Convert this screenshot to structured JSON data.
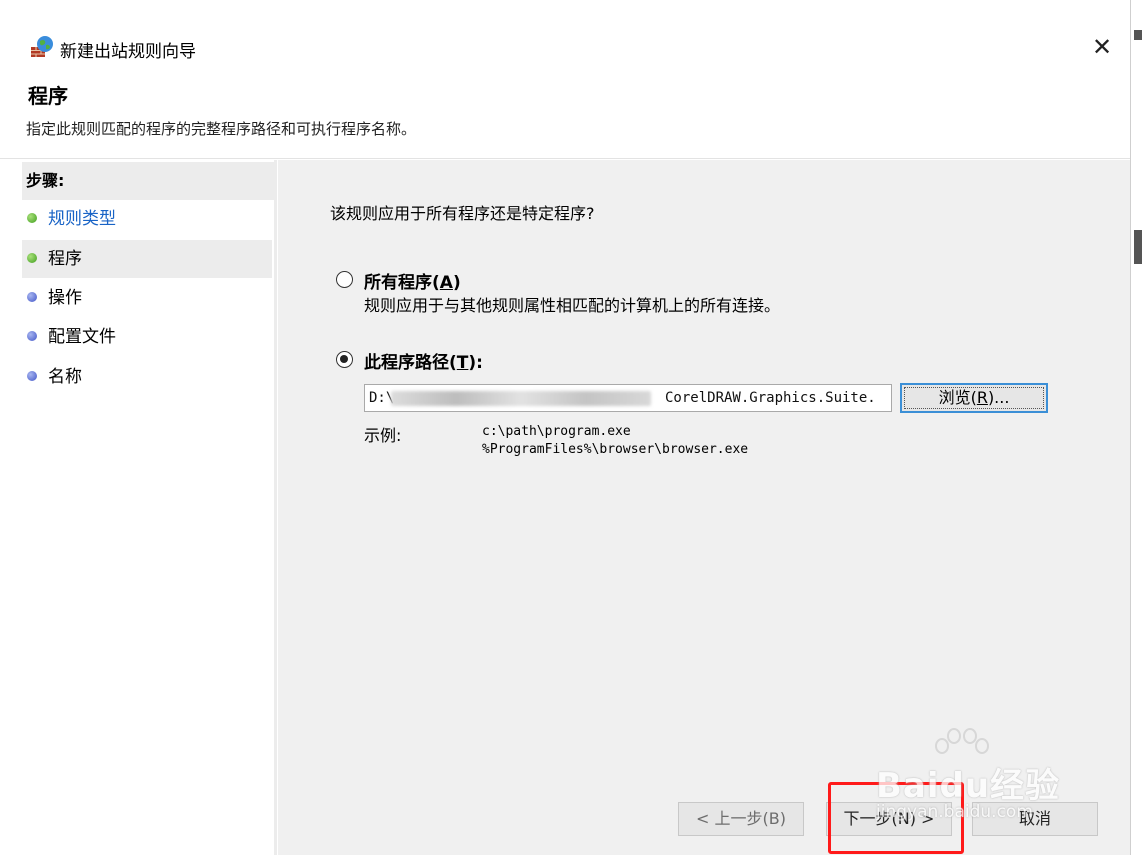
{
  "window": {
    "title": "新建出站规则向导",
    "close_glyph": "✕"
  },
  "header": {
    "title": "程序",
    "description": "指定此规则匹配的程序的完整程序路径和可执行程序名称。"
  },
  "sidebar": {
    "steps_label": "步骤:",
    "items": [
      {
        "label": "规则类型",
        "dot_color": "#3f9e1c",
        "state": "completed"
      },
      {
        "label": "程序",
        "dot_color": "#3f9e1c",
        "state": "current"
      },
      {
        "label": "操作",
        "dot_color": "#4155c8",
        "state": "pending"
      },
      {
        "label": "配置文件",
        "dot_color": "#4155c8",
        "state": "pending"
      },
      {
        "label": "名称",
        "dot_color": "#4155c8",
        "state": "pending"
      }
    ]
  },
  "content": {
    "question": "该规则应用于所有程序还是特定程序?",
    "all_programs": {
      "label_prefix": "所有程序(",
      "accel": "A",
      "label_suffix": ")",
      "description": "规则应用于与其他规则属性相匹配的计算机上的所有连接。",
      "checked": false
    },
    "program_path": {
      "label_prefix": "此程序路径(",
      "accel": "T",
      "label_suffix": "):",
      "checked": true,
      "value_start": "D:\\",
      "value_end": "CorelDRAW.Graphics.Suite."
    },
    "browse": {
      "label_prefix": "浏览(",
      "accel": "R",
      "label_suffix": ")..."
    },
    "example": {
      "label": "示例:",
      "lines": [
        "c:\\path\\program.exe",
        "%ProgramFiles%\\browser\\browser.exe"
      ]
    }
  },
  "footer": {
    "back": "< 上一步(B)",
    "next": "下一步(N) >",
    "cancel": "取消"
  },
  "watermark": {
    "brand": "Baidu经验",
    "url": "jingyan.baidu.com"
  },
  "colors": {
    "link": "#1863c6",
    "focus_border": "#3b8fd6",
    "highlight": "#ff1a1a",
    "content_bg": "#f0f0f0"
  }
}
